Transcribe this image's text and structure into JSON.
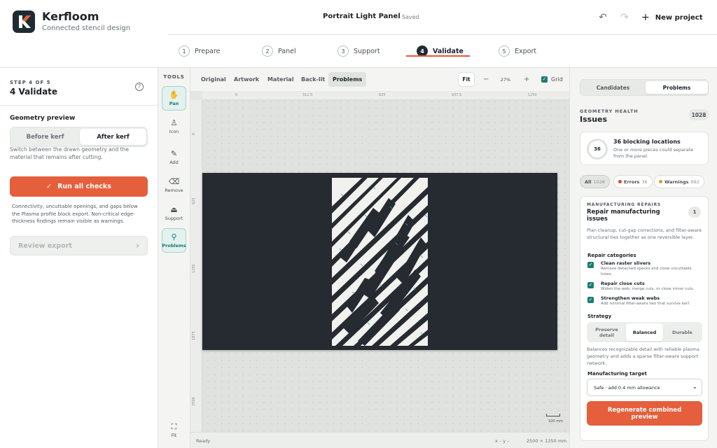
{
  "header": {
    "brand": "Kerfloom",
    "tagline": "Connected stencil design",
    "project_title": "Portrait Light Panel",
    "save_status": "Saved",
    "new_project_label": "New project"
  },
  "stepper": {
    "steps": [
      {
        "num": "1",
        "label": "Prepare"
      },
      {
        "num": "2",
        "label": "Panel"
      },
      {
        "num": "3",
        "label": "Support"
      },
      {
        "num": "4",
        "label": "Validate"
      },
      {
        "num": "5",
        "label": "Export"
      }
    ],
    "active_index": 3
  },
  "left_panel": {
    "eyebrow": "STEP 4 OF 5",
    "heading": "4 Validate",
    "geometry_label": "Geometry preview",
    "seg_before": "Before kerf",
    "seg_after": "After kerf",
    "geometry_help": "Switch between the drawn geometry and the material that remains after cutting.",
    "run_button": "Run all checks",
    "run_help": "Connectivity, uncuttable openings, and gaps below the Plasma profile block export. Non-critical edge-thickness findings remain visible as warnings.",
    "review_button": "Review export"
  },
  "tools": {
    "title": "TOOLS",
    "items": [
      {
        "label": "Pan",
        "icon": "hand-icon"
      },
      {
        "label": "Icon",
        "icon": "figure-icon"
      },
      {
        "label": "Add",
        "icon": "pen-plus-icon"
      },
      {
        "label": "Remove",
        "icon": "eraser-icon"
      },
      {
        "label": "Support",
        "icon": "support-icon"
      },
      {
        "label": "Problems",
        "icon": "magnifier-icon"
      }
    ],
    "fit_label": "Fit"
  },
  "toolbar": {
    "views": [
      "Original",
      "Artwork",
      "Material",
      "Back-lit",
      "Problems"
    ],
    "selected_view": "Problems",
    "fit_label": "Fit",
    "zoom": "27%",
    "grid_label": "Grid"
  },
  "rulers": {
    "top": [
      "0",
      "312.5",
      "625",
      "937.5",
      "1250"
    ],
    "left": [
      "0",
      "625",
      "1250",
      "1875",
      "2500"
    ]
  },
  "canvas": {
    "scale_label": "100 mm"
  },
  "statusbar": {
    "ready": "Ready",
    "coords": "x –   y –",
    "size": "2500 × 1250 mm"
  },
  "right_panel": {
    "tab_candidates": "Candidates",
    "tab_problems": "Problems",
    "gh_eyebrow": "GEOMETRY HEALTH",
    "gh_title": "Issues",
    "gh_count": "1028",
    "blocking_count": "36",
    "blocking_title": "36 blocking locations",
    "blocking_sub": "One or more pieces could separate from the panel.",
    "filters": [
      {
        "label": "All",
        "count": "1028"
      },
      {
        "label": "Errors",
        "count": "36"
      },
      {
        "label": "Warnings",
        "count": "992"
      }
    ],
    "repairs": {
      "eyebrow": "MANUFACTURING REPAIRS",
      "title": "Repair manufacturing issues",
      "badge": "1",
      "desc": "Plan cleanup, cut-gap corrections, and filter-aware structural ties together as one reversible layer.",
      "categories_label": "Repair categories",
      "categories": [
        {
          "title": "Clean raster slivers",
          "desc": "Remove detached specks and close uncuttable holes."
        },
        {
          "title": "Repair close cuts",
          "desc": "Widen the web, merge cuts, or close minor cuts."
        },
        {
          "title": "Strengthen weak webs",
          "desc": "Add minimal filter-aware ties that survive kerf."
        }
      ],
      "strategy_label": "Strategy",
      "strategies": [
        "Preserve detail",
        "Balanced",
        "Durable"
      ],
      "selected_strategy": "Balanced",
      "strategy_help": "Balances recognizable detail with reliable plasma geometry and adds a sparse filter-aware support network.",
      "target_label": "Manufacturing target",
      "target_value": "Safe · add 0.4 mm allowance",
      "regen_button": "Regenerate combined preview"
    }
  },
  "colors": {
    "accent": "#e55f3c",
    "teal": "#1a7c70",
    "dark": "#1e2b33",
    "panel": "#262a31"
  }
}
